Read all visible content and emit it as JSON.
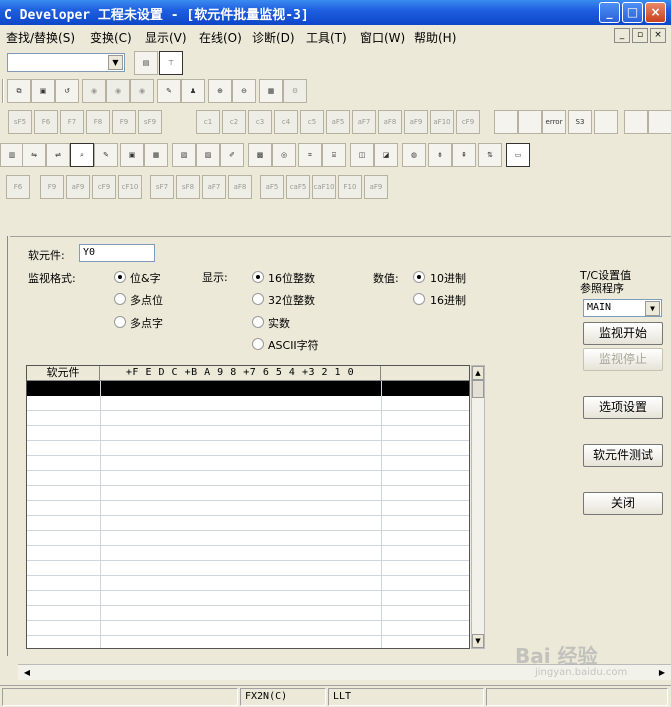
{
  "window": {
    "title": "C Developer 工程未设置 - [软元件批量监视-3]",
    "minimize": "_",
    "maximize": "□",
    "close": "×"
  },
  "menu": {
    "items": [
      "查找/替换(S)",
      "变换(C)",
      "显示(V)",
      "在线(O)",
      "诊断(D)",
      "工具(T)",
      "窗口(W)",
      "帮助(H)"
    ],
    "mdi_min": "_",
    "mdi_restore": "▫",
    "mdi_close": "×"
  },
  "toolbar": {
    "combo_value": "",
    "row3": [
      "sF5",
      "F6",
      "F7",
      "F8",
      "F9",
      "sF9",
      "c1",
      "c2",
      "c3",
      "c4",
      "c5",
      "aF5",
      "aF7",
      "aF8",
      "aF9",
      "aF10",
      "cF9",
      "",
      "",
      "error",
      "S3",
      "",
      "",
      ""
    ],
    "row5": [
      "F6",
      "F9",
      "aF9",
      "cF9",
      "cF10",
      "sF7",
      "sF8",
      "aF7",
      "aF8",
      "aF5",
      "caF5",
      "caF10",
      "F10",
      "aF9"
    ]
  },
  "dialog": {
    "device_label": "软元件:",
    "device_value": "Y0",
    "monitor_format_label": "监视格式:",
    "format_options": [
      "位&字",
      "多点位",
      "多点字"
    ],
    "display_label": "显示:",
    "display_options": [
      "16位整数",
      "32位整数",
      "实数",
      "ASCII字符"
    ],
    "value_label": "数值:",
    "value_options": [
      "10进制",
      "16进制"
    ],
    "tc_label_1": "T/C设置值",
    "tc_label_2": "参照程序",
    "tc_select": "MAIN",
    "buttons": {
      "start": "监视开始",
      "stop": "监视停止",
      "options": "选项设置",
      "test": "软元件测试",
      "close": "关闭"
    }
  },
  "grid": {
    "headers": [
      "软元件",
      "+F E D C  +B A 9 8  +7 6 5 4  +3 2 1 0",
      ""
    ]
  },
  "status": {
    "cpu": "FX2N(C)",
    "mode": "LLT"
  },
  "watermark": {
    "brand": "Bai 经验",
    "url": "jingyan.baidu.com"
  }
}
